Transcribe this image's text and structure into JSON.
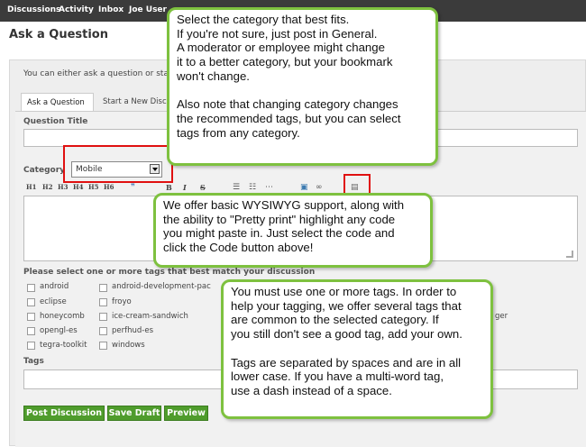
{
  "topnav": [
    "Discussions",
    "Activity",
    "Inbox",
    "Joe User"
  ],
  "page_title": "Ask a Question",
  "intro": "You can either ask a question or start",
  "tabs": [
    "Ask a Question",
    "Start a New Discus"
  ],
  "labels": {
    "question_title": "Question Title",
    "category": "Category",
    "tags_prompt": "Please select one or more tags that best match your discussion",
    "tags": "Tags"
  },
  "category_value": "Mobile",
  "toolbar": [
    "H1",
    "H2",
    "H3",
    "H4",
    "H5",
    "H6",
    "B",
    "I",
    "S"
  ],
  "tags_col1": [
    "android",
    "eclipse",
    "honeycomb",
    "opengl-es",
    "tegra-toolkit"
  ],
  "tags_col2": [
    "android-development-pac",
    "froyo",
    "ice-cream-sandwich",
    "perfhud-es",
    "windows"
  ],
  "tag_partial": "ger",
  "buttons": {
    "post": "Post Discussion",
    "save": "Save Draft",
    "preview": "Preview"
  },
  "callouts": {
    "category": "Select the category that best fits.\nIf you're not sure, just post in General.\nA moderator or employee might change\nit to a better category, but your bookmark\nwon't change.\n\nAlso note that changing category changes\nthe recommended tags, but you can select\ntags from any category.",
    "wysiwyg": "We offer basic WYSIWYG support, along with\nthe ability to \"Pretty print\" highlight any code\nyou might paste in.  Just select the code and\nclick the Code button above!",
    "tags": "You must use one or more tags.  In order to\nhelp your tagging, we offer several tags that\nare common to the selected category.  If\nyou still don't see a good tag, add your own.\n\nTags are separated by spaces and are in all\nlower case.  If you have a multi-word tag,\nuse a dash instead of a space."
  },
  "colors": {
    "topbar": "#3b3b3b",
    "button_green": "#4f9c2c",
    "callout_border": "#7ec13f",
    "highlight_red": "#e01010"
  }
}
